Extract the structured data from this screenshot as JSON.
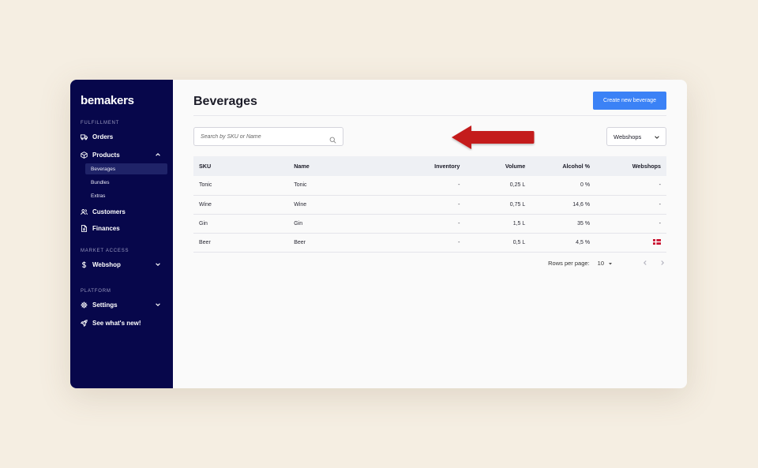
{
  "app": {
    "logo": "bemakers"
  },
  "sidebar": {
    "sections": [
      {
        "label": "FULFILLMENT"
      },
      {
        "label": "MARKET ACCESS"
      },
      {
        "label": "PLATFORM"
      }
    ],
    "items": {
      "orders": {
        "label": "Orders",
        "icon": "truck-icon"
      },
      "products": {
        "label": "Products",
        "icon": "box-icon",
        "expanded": true
      },
      "customers": {
        "label": "Customers",
        "icon": "users-icon"
      },
      "finances": {
        "label": "Finances",
        "icon": "document-icon"
      },
      "webshop": {
        "label": "Webshop",
        "icon": "dollar-icon"
      },
      "settings": {
        "label": "Settings",
        "icon": "gear-icon"
      },
      "whats_new": {
        "label": "See what's new!",
        "icon": "rocket-icon"
      }
    },
    "product_subitems": [
      {
        "label": "Beverages",
        "active": true
      },
      {
        "label": "Bundles",
        "active": false
      },
      {
        "label": "Extras",
        "active": false
      }
    ]
  },
  "main": {
    "title": "Beverages",
    "create_button": "Create new beverage",
    "search": {
      "placeholder": "Search by SKU or Name",
      "value": ""
    },
    "webshops_filter": "Webshops",
    "table": {
      "columns": [
        "SKU",
        "Name",
        "Inventory",
        "Volume",
        "Alcohol %",
        "Webshops"
      ],
      "rows": [
        [
          "Tonic",
          "Tonic",
          "-",
          "0,25 L",
          "0 %",
          "-"
        ],
        [
          "Wine",
          "Wine",
          "-",
          "0,75 L",
          "14,6 %",
          "-"
        ],
        [
          "Gin",
          "Gin",
          "-",
          "1,5 L",
          "35 %",
          "-"
        ],
        [
          "Beer",
          "Beer",
          "-",
          "0,5 L",
          "4,5 %",
          "flag-denmark"
        ]
      ]
    },
    "pagination": {
      "rows_per_page_label": "Rows per page:",
      "rows_per_page": "10"
    }
  },
  "colors": {
    "sidebar_bg": "#07074b",
    "accent": "#3b82f6",
    "arrow": "#c41e1e",
    "page_bg": "#f5eee2"
  }
}
